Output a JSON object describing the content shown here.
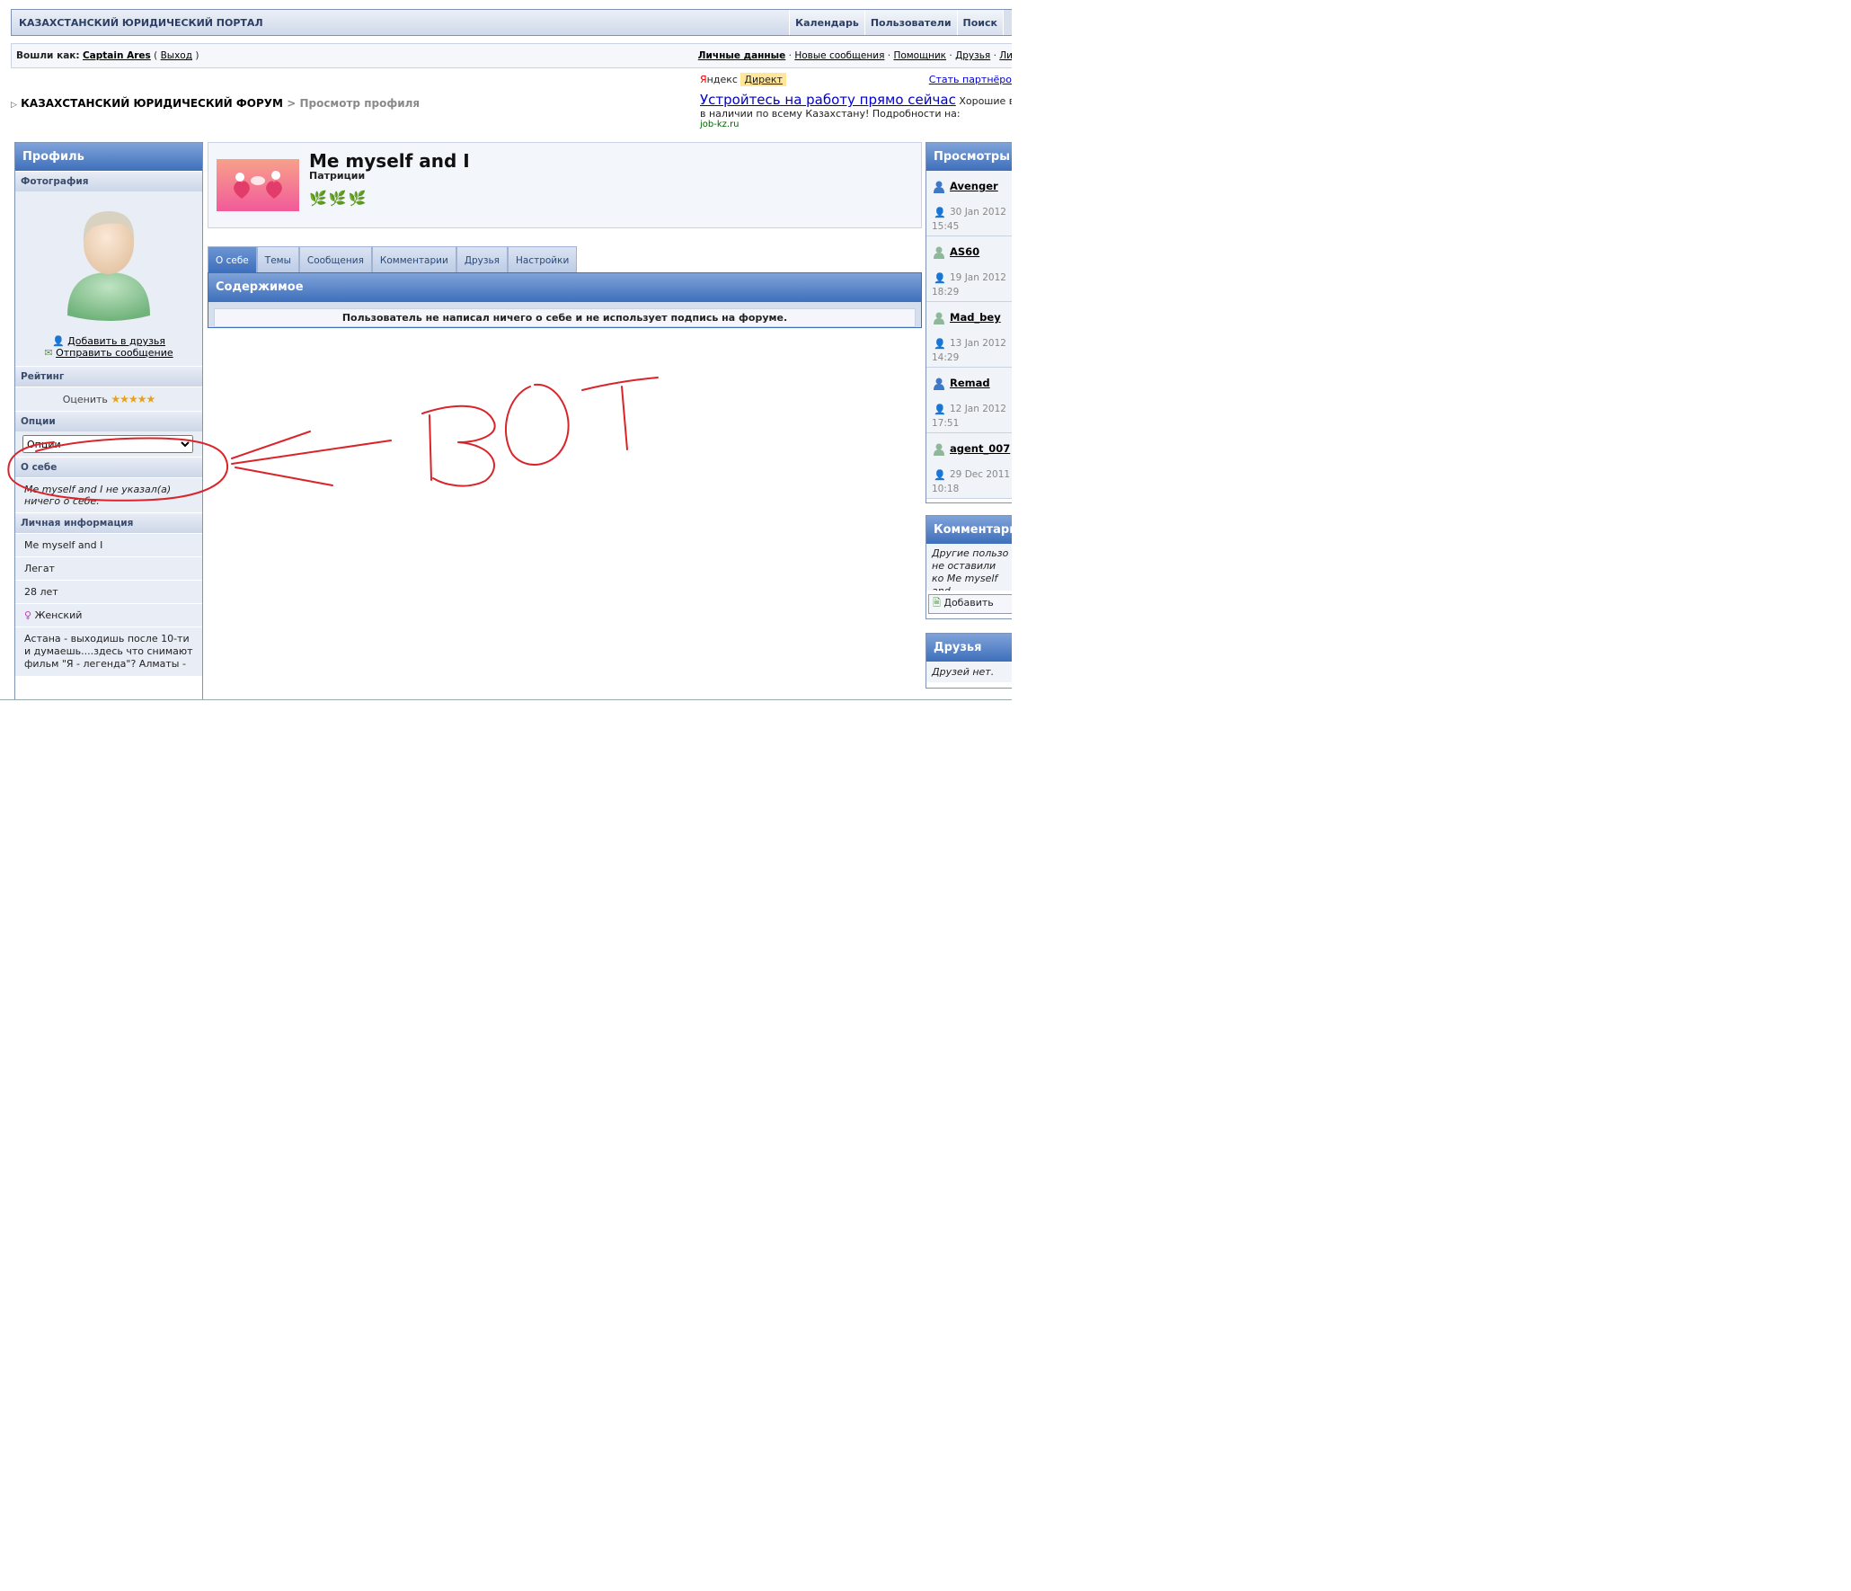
{
  "header": {
    "portal_title": "КАЗАХСТАНСКИЙ ЮРИДИЧЕСКИЙ ПОРТАЛ",
    "nav": [
      "Календарь",
      "Пользователи",
      "Поиск"
    ]
  },
  "userbar": {
    "logged_in_label": "Вошли как:",
    "username": "Captain Ares",
    "paren_open": "(",
    "logout": "Выход",
    "paren_close": ")",
    "links": [
      "Личные данные",
      "Новые сообщения",
      "Помощник",
      "Друзья",
      "Ли"
    ],
    "separator": "·"
  },
  "breadcrumb": {
    "forum": "КАЗАХСТАНСКИЙ ЮРИДИЧЕСКИЙ ФОРУМ",
    "sep": ">",
    "current": "Просмотр профиля"
  },
  "ad": {
    "brand_ya": "Я",
    "brand_rest": "ндекс",
    "direct": "Директ",
    "partner": "Стать партнёро",
    "title": "Устройтесь на работу прямо сейчас",
    "text_tail": "Хорошие вак",
    "text2": "в наличии по всему Казахстану! Подробности на:",
    "site": "job-kz.ru"
  },
  "left": {
    "title": "Профиль",
    "photo_head": "Фотография",
    "add_friend": "Добавить в друзья",
    "send_message": "Отправить сообщение",
    "rating_head": "Рейтинг",
    "rate_label": "Оценить",
    "options_head": "Опции",
    "options_value": "Опции",
    "about_head": "О себе",
    "about_text": "Me myself and I не указал(а) ничего о себе.",
    "personal_head": "Личная информация",
    "personal_name": "Me myself and I",
    "personal_rank": "Легат",
    "personal_age": "28 лет",
    "personal_gender": "Женский",
    "personal_location": "Астана - выходишь после 10-ти и думаешь....здесь что снимают фильм \"Я - легенда\"? Алматы - "
  },
  "profile": {
    "name": "Me myself and I",
    "group": "Патриции",
    "leaves": "🌿🌿🌿"
  },
  "tabs": [
    "О себе",
    "Темы",
    "Сообщения",
    "Комментарии",
    "Друзья",
    "Настройки"
  ],
  "content": {
    "title": "Содержимое",
    "message": "Пользователь не написал ничего о себе и не использует подпись на форуме."
  },
  "views": {
    "title": "Просмотры",
    "items": [
      {
        "user": "Avenger",
        "date": "30 Jan 2012",
        "time": "15:45",
        "color": "#3e78c6"
      },
      {
        "user": "AS60",
        "date": "19 Jan 2012",
        "time": "18:29",
        "color": "#8fb89a"
      },
      {
        "user": "Mad_bey",
        "date": "13 Jan 2012",
        "time": "14:29",
        "color": "#8fb89a"
      },
      {
        "user": "Remad",
        "date": "12 Jan 2012",
        "time": "17:51",
        "color": "#3e78c6"
      },
      {
        "user": "agent_007",
        "date": "29 Dec 2011",
        "time": "10:18",
        "color": "#8fb89a"
      }
    ]
  },
  "comments": {
    "title": "Комментарии",
    "text": "Другие пользо не оставили ко Me myself and",
    "add": "Добавить"
  },
  "friends": {
    "title": "Друзья",
    "text": "Друзей нет."
  },
  "annotation": {
    "text": "ВОТ",
    "color": "#d9242a"
  }
}
